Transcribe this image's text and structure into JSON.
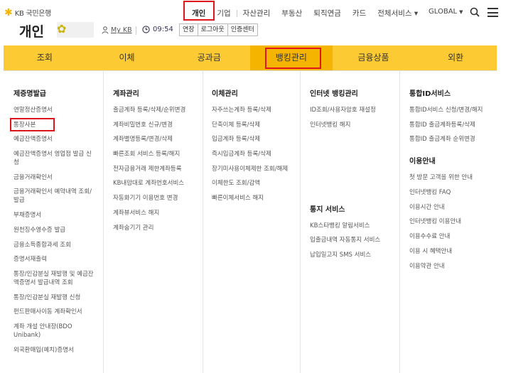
{
  "brand": {
    "logo_text": "KB 국민은행"
  },
  "top_nav": {
    "items": [
      "개인",
      "기업",
      "자산관리",
      "부동산",
      "퇴직연금",
      "카드",
      "전체서비스 ▾"
    ],
    "global_label": "GLOBAL"
  },
  "header": {
    "title": "개인",
    "my_kb": "My KB",
    "timer": "09:54",
    "buttons": [
      "연장",
      "로그아웃",
      "인증센터"
    ]
  },
  "main_menu": [
    "조회",
    "이체",
    "공과금",
    "뱅킹관리",
    "금융상품",
    "외환"
  ],
  "columns": [
    {
      "title": "제증명발급",
      "items": [
        "연말정산증명서",
        "통장사본",
        "예금잔액증명서",
        "예금잔액증명서 영업점 발급 신청",
        "금융거래확인서",
        "금융거래확인서 예약내역 조회/발급",
        "부채증명서",
        "원천징수영수증 발급",
        "금융소득종합과세 조회",
        "증명서재출력",
        "통장/인감분실 재발행 및 예금잔액증명서 발급내역 조회",
        "통장/인감분실 재발행 신청",
        "펀드판매사이동 계좌확인서",
        "계좌 개설 안내장(BDO Unibank)",
        "외국환매입(예치)증명서"
      ]
    },
    {
      "title": "계좌관리",
      "items": [
        "출금계좌 등록/삭제/순위변경",
        "계좌비밀번호 신규/변경",
        "계좌별명등록/변경/삭제",
        "빠른조회 서비스 등록/해지",
        "전자금융거래 제한계좌등록",
        "KB내맘대로 계좌번호서비스",
        "자동화기기 이용번호 변경",
        "계좌뷰서비스 해지",
        "계좌숨기기 관리"
      ]
    },
    {
      "title": "이체관리",
      "items": [
        "자주쓰는계좌 등록/삭제",
        "단축이체 등록/삭제",
        "입금계좌 등록/삭제",
        "즉시입금계좌 등록/삭제",
        "장기미사용이체제한 조회/해제",
        "이체한도 조회/감액",
        "빠른이체서비스 해지"
      ]
    },
    {
      "title": "인터넷 뱅킹관리",
      "items": [
        "ID조회/사용자암호 재설정",
        "인터넷뱅킹 해지"
      ],
      "sub_title": "통지 서비스",
      "sub_items": [
        "KB스타뱅킹 알림서비스",
        "입출금내역 자동통지 서비스",
        "납입일고지 SMS 서비스"
      ]
    },
    {
      "title": "통합ID서비스",
      "items": [
        "통합ID서비스 신청/변경/해지",
        "통합ID 출금계좌등록/삭제",
        "통합ID 출금계좌 순위변경"
      ],
      "sub_title": "이용안내",
      "sub_items": [
        "첫 방문 고객을 위한 안내",
        "인터넷뱅킹 FAQ",
        "이용시간 안내",
        "인터넷뱅킹 이용안내",
        "이용수수료 안내",
        "이용 시 혜택안내",
        "이용약관 안내"
      ]
    }
  ]
}
